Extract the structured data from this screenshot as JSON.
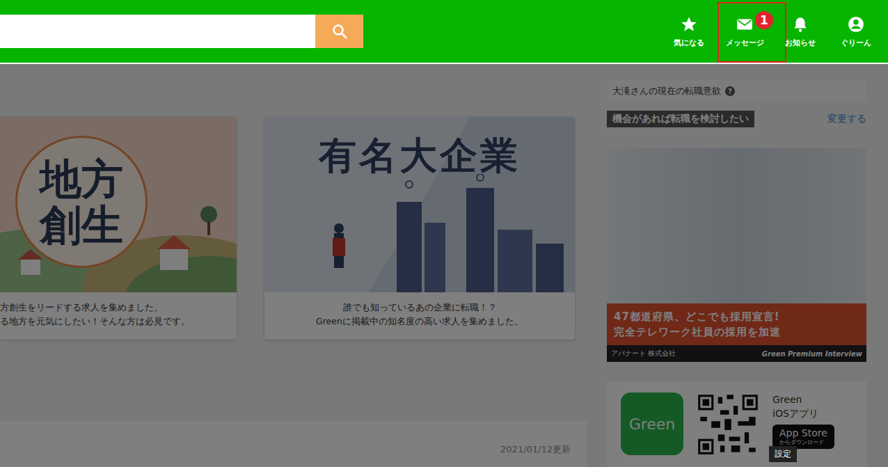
{
  "search": {
    "value": ""
  },
  "nav": [
    {
      "label": "気になる",
      "kind": "star",
      "selected": false,
      "badge": ""
    },
    {
      "label": "メッセージ",
      "kind": "mail",
      "selected": true,
      "badge": "1"
    },
    {
      "label": "お知らせ",
      "kind": "bell",
      "selected": false,
      "badge": ""
    },
    {
      "label": "ぐりーん",
      "kind": "user",
      "selected": false,
      "badge": ""
    }
  ],
  "features": [
    {
      "title": "地方創生",
      "kind": "local",
      "caption": [
        "方創生をリードする求人を集めました。",
        "る地方を元気にしたい！そんな方は必見です。"
      ]
    },
    {
      "title": "有名大企業",
      "kind": "enterprise",
      "caption": [
        "誰でも知っているあの企業に転職！？",
        "Greenに掲載中の知名度の高い求人を集めました。"
      ]
    }
  ],
  "feed": {
    "updated": "2021/01/12更新"
  },
  "sidebar": {
    "intent": {
      "title": "大滝さんの現在の転職意欲",
      "help": "?",
      "status": "機会があれば転職を検討したい",
      "change": "変更する"
    },
    "banner": {
      "headline": [
        "47都道府県、どこでも採用宣言!",
        "完全テレワーク社員の採用を加速"
      ],
      "company": "アパナート 株式会社",
      "series": "Green Premium Interview"
    },
    "app": {
      "logo": "Green",
      "name": [
        "Green",
        "iOSアプリ"
      ],
      "store": "App Store",
      "store_sub": "からダウンロード"
    }
  },
  "tooltip": "設定"
}
